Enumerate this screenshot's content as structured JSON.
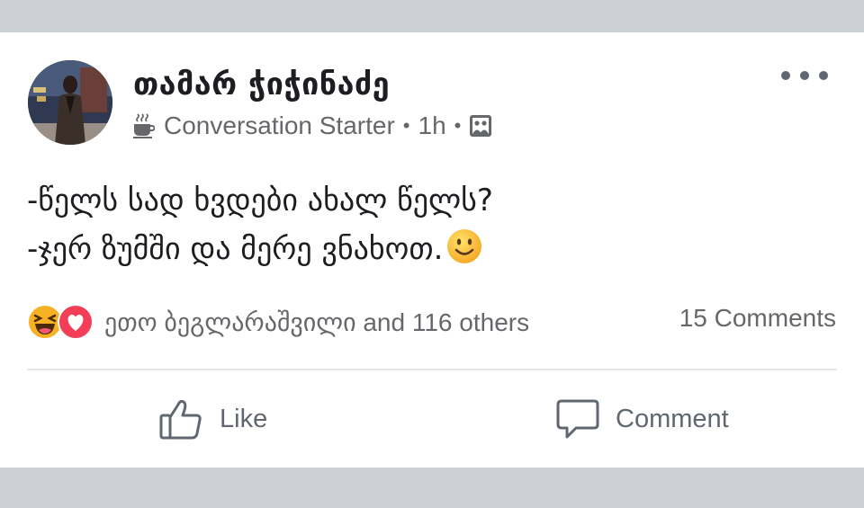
{
  "post": {
    "author_name": "თამარ ჭიჭინაძე",
    "badge_icon": "coffee-cup-icon",
    "badge_label": "Conversation Starter",
    "separator": "•",
    "time": "1h",
    "audience_icon": "group-audience-icon",
    "body_lines": [
      "-წელს სად ხვდები ახალ წელს?",
      "-ჯერ ზუმში და მერე ვნახოთ."
    ],
    "body_emoji": "slightly-smiling-face"
  },
  "reactions": {
    "icons": [
      "laughing-face-icon",
      "heart-icon"
    ],
    "summary": "ეთო ბეგლარაშვილი and 116 others",
    "comments_count": "15 Comments"
  },
  "actions": {
    "like_label": "Like",
    "comment_label": "Comment"
  },
  "colors": {
    "page_background": "#cdd0d4",
    "card_background": "#ffffff",
    "secondary_text": "#65676b",
    "love_red": "#f33e58",
    "haha_yellow": "#f7b125"
  }
}
